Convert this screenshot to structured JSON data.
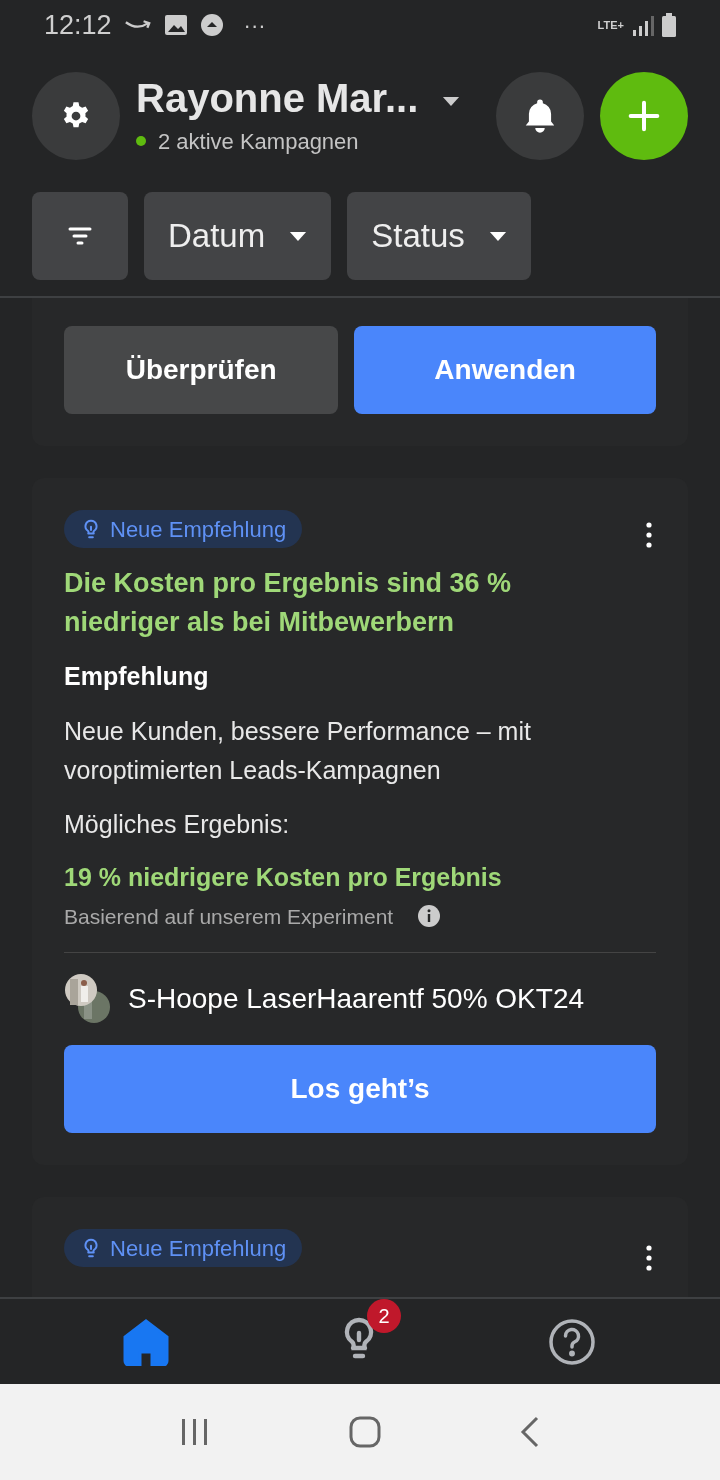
{
  "status_bar": {
    "time": "12:12",
    "more": "···",
    "network": "LTE+"
  },
  "header": {
    "account": "Rayonne Mar...",
    "subtitle": "2 aktive Kampagnen"
  },
  "filters": [
    {
      "kind": "icon"
    },
    {
      "kind": "dropdown",
      "label": "Datum"
    },
    {
      "kind": "dropdown",
      "label": "Status"
    }
  ],
  "cards": [
    {
      "kind": "actions",
      "buttons": [
        {
          "label": "Überprüfen",
          "primary": false
        },
        {
          "label": "Anwenden",
          "primary": true
        }
      ]
    },
    {
      "kind": "recommendation",
      "badge": "Neue Empfehlung",
      "headline": "Die Kosten pro Ergebnis sind 36 % niedriger als bei Mitbewerbern",
      "section": "Empfehlung",
      "description": "Neue Kunden, bessere Performance – mit voroptimierten Leads-Kampagnen",
      "result_label": "Mögliches Ergebnis:",
      "result": "19 % niedrigere Kosten pro Ergebnis",
      "note": "Basierend auf unserem Experiment",
      "campaign": "S-Hoope LaserHaarentf 50% OKT24",
      "cta": "Los geht’s"
    },
    {
      "kind": "teaser",
      "badge": "Neue Empfehlung"
    }
  ],
  "bottom_nav": [
    {
      "kind": "home",
      "selected": true
    },
    {
      "kind": "ideas",
      "selected": false,
      "badge": "2"
    },
    {
      "kind": "help",
      "selected": false
    }
  ]
}
